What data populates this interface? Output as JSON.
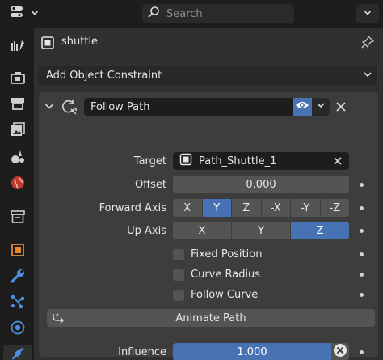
{
  "topbar": {
    "editor_type_icon": "properties-editor-icon",
    "search_placeholder": "Search"
  },
  "sidebar": {
    "tabs": [
      {
        "name": "tool-tab",
        "icon": "tool-icon"
      },
      {
        "name": "render-tab",
        "icon": "render-icon"
      },
      {
        "name": "output-tab",
        "icon": "output-icon"
      },
      {
        "name": "view-layer-tab",
        "icon": "view-layer-icon"
      },
      {
        "name": "scene-tab",
        "icon": "scene-icon"
      },
      {
        "name": "world-tab",
        "icon": "world-icon"
      },
      {
        "name": "collection-tab",
        "icon": "collection-icon"
      },
      {
        "name": "object-tab",
        "icon": "object-icon"
      },
      {
        "name": "modifier-tab",
        "icon": "wrench-icon"
      },
      {
        "name": "particles-tab",
        "icon": "particles-icon"
      },
      {
        "name": "physics-tab",
        "icon": "physics-icon"
      },
      {
        "name": "constraint-tab",
        "icon": "constraint-icon",
        "active": true
      }
    ]
  },
  "header": {
    "object_name": "shuttle"
  },
  "add_constraint": {
    "label": "Add Object Constraint"
  },
  "constraint": {
    "name": "Follow Path",
    "target_label": "Target",
    "target_value": "Path_Shuttle_1",
    "offset_label": "Offset",
    "offset_value": "0.000",
    "forward_axis_label": "Forward Axis",
    "forward_axis_options": [
      "X",
      "Y",
      "Z",
      "-X",
      "-Y",
      "-Z"
    ],
    "forward_axis_selected": "Y",
    "up_axis_label": "Up Axis",
    "up_axis_options": [
      "X",
      "Y",
      "Z"
    ],
    "up_axis_selected": "Z",
    "fixed_position_label": "Fixed Position",
    "curve_radius_label": "Curve Radius",
    "follow_curve_label": "Follow Curve",
    "animate_path_label": "Animate Path",
    "influence_label": "Influence",
    "influence_value": "1.000"
  },
  "colors": {
    "accent": "#4772b3",
    "panel": "#303030",
    "box": "#3d3d3d",
    "field": "#545454",
    "orange": "#e8872b",
    "blue": "#4d8fe0"
  }
}
